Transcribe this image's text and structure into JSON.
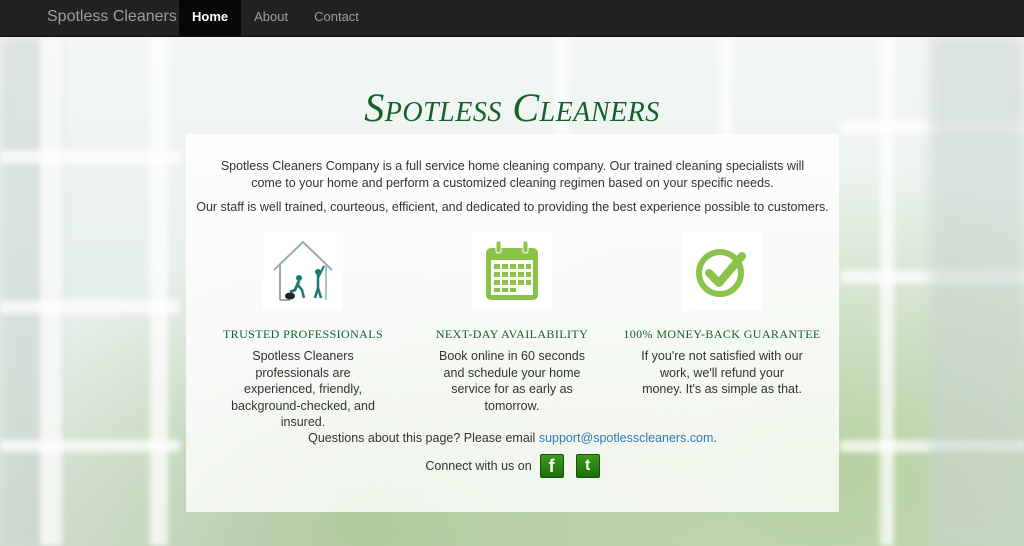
{
  "navbar": {
    "brand": "Spotless Cleaners",
    "items": [
      {
        "label": "Home",
        "active": true
      },
      {
        "label": "About",
        "active": false
      },
      {
        "label": "Contact",
        "active": false
      }
    ]
  },
  "hero": {
    "title": "Spotless Cleaners"
  },
  "intro": {
    "p1": "Spotless Cleaners Company is a full service home cleaning company. Our trained cleaning specialists will come to your home and perform a customized cleaning regimen based on your specific needs.",
    "p2": "Our staff is well trained, courteous, efficient, and dedicated to providing the best experience possible to customers."
  },
  "features": [
    {
      "icon": "house-cleaning-icon",
      "heading": "TRUSTED PROFESSIONALS",
      "text": "Spotless Cleaners professionals are experienced, friendly, background-checked, and insured."
    },
    {
      "icon": "calendar-icon",
      "heading": "NEXT-DAY AVAILABILITY",
      "text": "Book online in 60 seconds and schedule your home service for as early as tomorrow."
    },
    {
      "icon": "checkmark-icon",
      "heading": "100% MONEY-BACK GUARANTEE",
      "text": "If you're not satisfied with our work, we'll refund your money. It's as simple as that."
    }
  ],
  "footer": {
    "question": "Questions about this page? Please email",
    "email": "support@spotlesscleaners.com",
    "period": ".",
    "connect": "Connect with us on",
    "facebook": "f",
    "twitter": "t"
  },
  "colors": {
    "accent_green": "#14602a",
    "icon_green": "#8bc34a",
    "link": "#337ab7",
    "navbar": "#222222"
  }
}
